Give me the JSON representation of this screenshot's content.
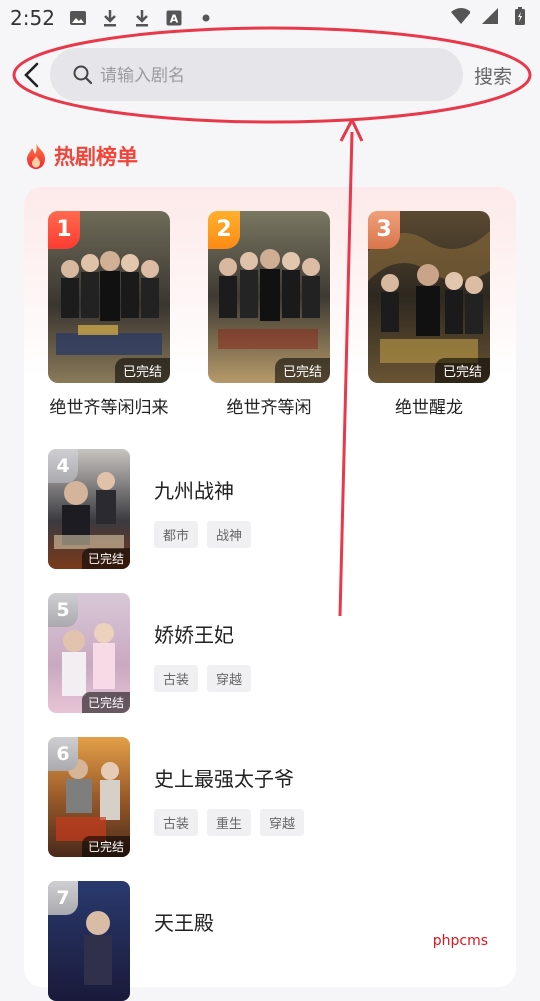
{
  "status_bar": {
    "time": "2:52"
  },
  "search": {
    "placeholder": "请输入剧名",
    "button": "搜索"
  },
  "section": {
    "title": "热剧榜单"
  },
  "top3": [
    {
      "rank": "1",
      "title": "绝世齐等闲归来",
      "status": "已完结",
      "badge_color": "#ff4b3e"
    },
    {
      "rank": "2",
      "title": "绝世齐等闲",
      "status": "已完结",
      "badge_color": "#ff9d1f"
    },
    {
      "rank": "3",
      "title": "绝世醒龙",
      "status": "已完结",
      "badge_color": "#e08a60"
    }
  ],
  "list": [
    {
      "rank": "4",
      "title": "九州战神",
      "status": "已完结",
      "tags": [
        "都市",
        "战神"
      ]
    },
    {
      "rank": "5",
      "title": "娇娇王妃",
      "status": "已完结",
      "tags": [
        "古装",
        "穿越"
      ]
    },
    {
      "rank": "6",
      "title": "史上最强太子爷",
      "status": "已完结",
      "tags": [
        "古装",
        "重生",
        "穿越"
      ]
    },
    {
      "rank": "7",
      "title": "天王殿",
      "status": "",
      "tags": []
    }
  ],
  "watermark": "phpcms",
  "colors": {
    "accent": "#f0453a",
    "annotation": "#e8394a"
  }
}
